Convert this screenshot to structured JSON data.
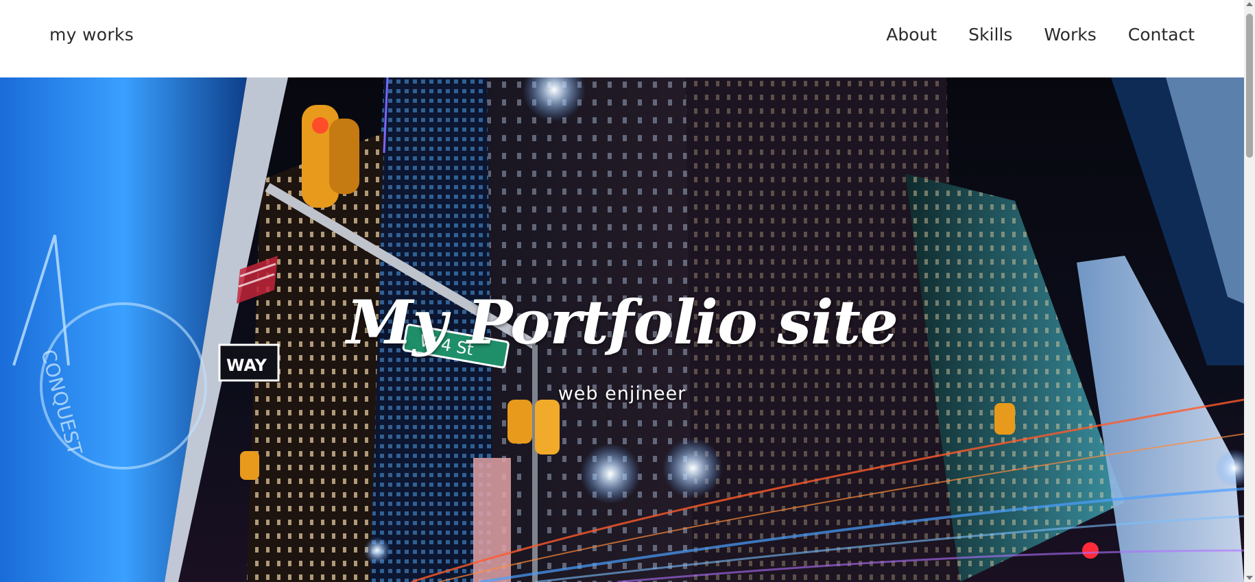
{
  "header": {
    "logo_text": "my works",
    "nav": [
      {
        "label": "About"
      },
      {
        "label": "Skills"
      },
      {
        "label": "Works"
      },
      {
        "label": "Contact"
      }
    ]
  },
  "hero": {
    "title": "My Portfolio site",
    "subtitle": "web enjineer",
    "street_sign": "W 4 St",
    "one_way_sign": "WAY",
    "billboard_text": "CONQUEST"
  },
  "colors": {
    "header_bg": "#ffffff",
    "nav_text": "#2b2b2b",
    "hero_text": "#ffffff",
    "night_sky": "#090b16",
    "neon_blue": "#2a8cff",
    "street_sign_green": "#1f8f6a",
    "traffic_light_amber": "#e89a1c"
  }
}
